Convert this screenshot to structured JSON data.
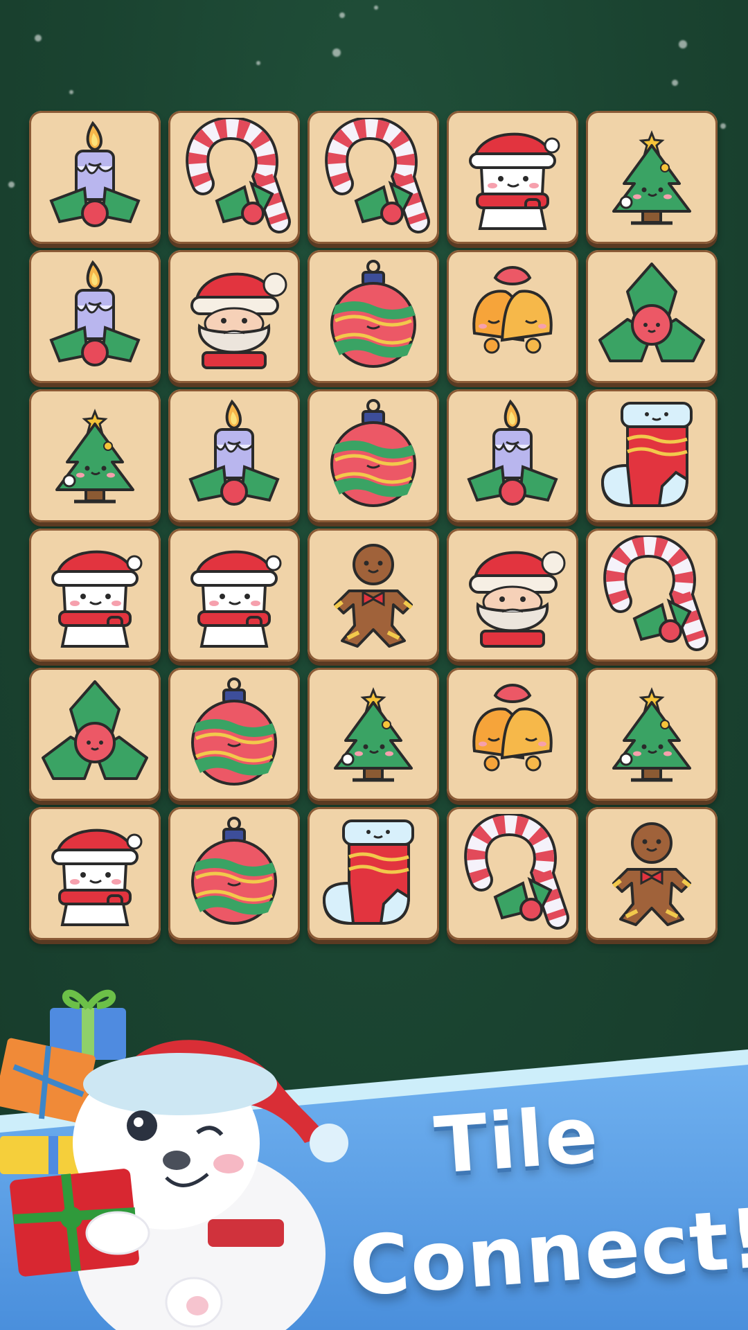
{
  "game": {
    "title_line1": "Tile",
    "title_line2": "Connect!",
    "colors": {
      "background": "#1b4531",
      "tile_face": "#f0d3a8",
      "tile_border": "#8a5a36",
      "banner_blue": "#5b9ee6",
      "title_text": "#ffffff"
    }
  },
  "board": {
    "rows": 6,
    "cols": 5,
    "tiles": [
      [
        "candle-icon",
        "candy-cane-icon",
        "candy-cane-icon",
        "snowman-icon",
        "christmas-tree-icon"
      ],
      [
        "candle-icon",
        "santa-icon",
        "ornament-icon",
        "bells-icon",
        "holly-icon"
      ],
      [
        "christmas-tree-icon",
        "candle-icon",
        "ornament-icon",
        "candle-icon",
        "stocking-icon"
      ],
      [
        "snowman-icon",
        "snowman-icon",
        "gingerbread-icon",
        "santa-icon",
        "candy-cane-icon"
      ],
      [
        "holly-icon",
        "ornament-icon",
        "christmas-tree-icon",
        "bells-icon",
        "christmas-tree-icon"
      ],
      [
        "snowman-icon",
        "ornament-icon",
        "stocking-icon",
        "candy-cane-icon",
        "gingerbread-icon"
      ]
    ]
  },
  "decor": {
    "mascot": "polar-bear-icon",
    "gifts": [
      "gift-blue-icon",
      "gift-orange-icon",
      "gift-yellow-icon",
      "gift-red-icon"
    ]
  }
}
